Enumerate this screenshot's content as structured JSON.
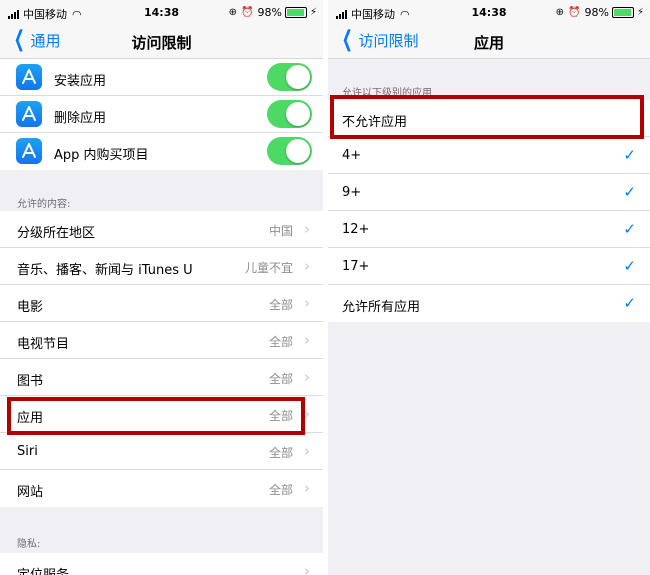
{
  "left": {
    "status": {
      "carrier": "中国移动",
      "time": "14:38",
      "battery": "98%"
    },
    "nav": {
      "back_label": "通用",
      "title": "访问限制"
    },
    "toggles": [
      {
        "label": "安装应用",
        "on": true
      },
      {
        "label": "删除应用",
        "on": true
      },
      {
        "label": "App 内购买项目",
        "on": true
      }
    ],
    "allowed_content_header": "允许的内容:",
    "content_rows": [
      {
        "label": "分级所在地区",
        "value": "中国"
      },
      {
        "label": "音乐、播客、新闻与 iTunes U",
        "value": "儿童不宜"
      },
      {
        "label": "电影",
        "value": "全部"
      },
      {
        "label": "电视节目",
        "value": "全部"
      },
      {
        "label": "图书",
        "value": "全部"
      },
      {
        "label": "应用",
        "value": "全部"
      },
      {
        "label": "Siri",
        "value": "全部"
      },
      {
        "label": "网站",
        "value": "全部"
      }
    ],
    "privacy_header": "隐私:",
    "privacy_rows": [
      {
        "label": "定位服务"
      }
    ]
  },
  "right": {
    "status": {
      "carrier": "中国移动",
      "time": "14:38",
      "battery": "98%"
    },
    "nav": {
      "back_label": "访问限制",
      "title": "应用"
    },
    "section_header": "允许以下级别的应用",
    "options": [
      {
        "label": "不允许应用",
        "checked": false
      },
      {
        "label": "4+",
        "checked": true
      },
      {
        "label": "9+",
        "checked": true
      },
      {
        "label": "12+",
        "checked": true
      },
      {
        "label": "17+",
        "checked": true
      },
      {
        "label": "允许所有应用",
        "checked": true
      }
    ]
  },
  "colors": {
    "accent": "#007aff",
    "toggle_on": "#4cd964",
    "highlight": "#b30000",
    "group_bg": "#efeff4"
  }
}
